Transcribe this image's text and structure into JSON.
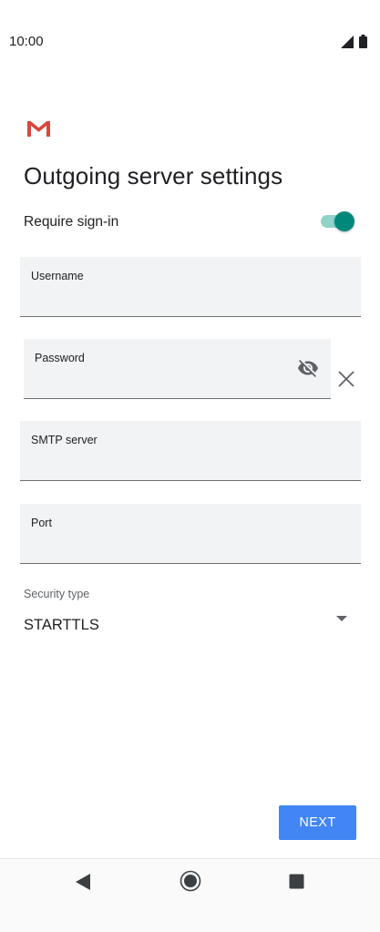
{
  "status_bar": {
    "time": "10:00",
    "icons": [
      "signal-icon",
      "battery-icon"
    ]
  },
  "app": {
    "logo": "gmail-logo",
    "title": "Outgoing server settings"
  },
  "require_signin": {
    "label": "Require sign-in",
    "enabled": true
  },
  "fields": {
    "username": {
      "label": "Username",
      "value": ""
    },
    "password": {
      "label": "Password",
      "value": "",
      "icons": [
        "visibility-off-icon",
        "clear-icon"
      ]
    },
    "smtp_server": {
      "label": "SMTP server",
      "value": ""
    },
    "port": {
      "label": "Port",
      "value": ""
    }
  },
  "security_type": {
    "label": "Security type",
    "value": "STARTTLS"
  },
  "actions": {
    "next_label": "NEXT"
  },
  "nav_bar": {
    "icons": [
      "back-icon",
      "home-icon",
      "recents-icon"
    ]
  },
  "colors": {
    "accent": "#00897b",
    "button": "#4285f4",
    "field_bg": "#f1f3f4"
  }
}
